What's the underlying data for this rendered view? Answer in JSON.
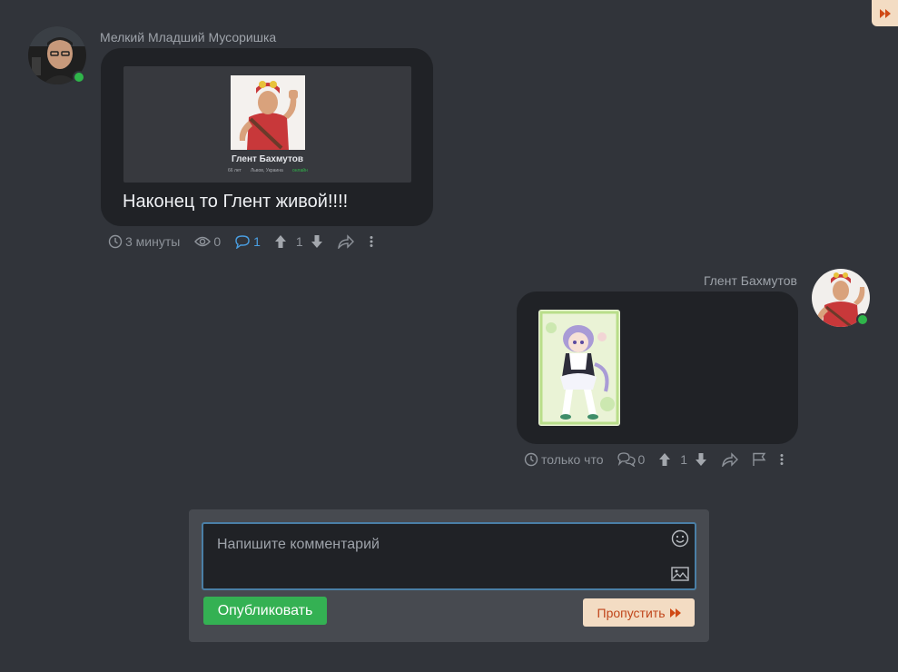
{
  "corner_skip": {
    "icon": "fast-forward-icon",
    "color": "#d04a16"
  },
  "posts": [
    {
      "author": "Мелкий Младший Мусоришка",
      "online": true,
      "embed": {
        "name": "Глент Бахмутов",
        "age": "66 лет",
        "location": "Львов, Украина",
        "status": "онлайн"
      },
      "text": "Наконец то Глент живой!!!!",
      "time": "3 минуты",
      "views": "0",
      "comments": "1",
      "votes": "1"
    },
    {
      "author": "Глент Бахмутов",
      "online": true,
      "attachment": "anime-image",
      "time": "только что",
      "comments": "0",
      "votes": "1"
    }
  ],
  "composer": {
    "placeholder": "Напишите комментарий",
    "publish_label": "Опубликовать",
    "skip_label": "Пропустить"
  },
  "colors": {
    "background": "#31343a",
    "bubble": "#202226",
    "accent_green": "#34b153",
    "skip_bg": "#f3dcc3",
    "skip_text": "#c0461b",
    "link_blue": "#4a9fe2"
  }
}
